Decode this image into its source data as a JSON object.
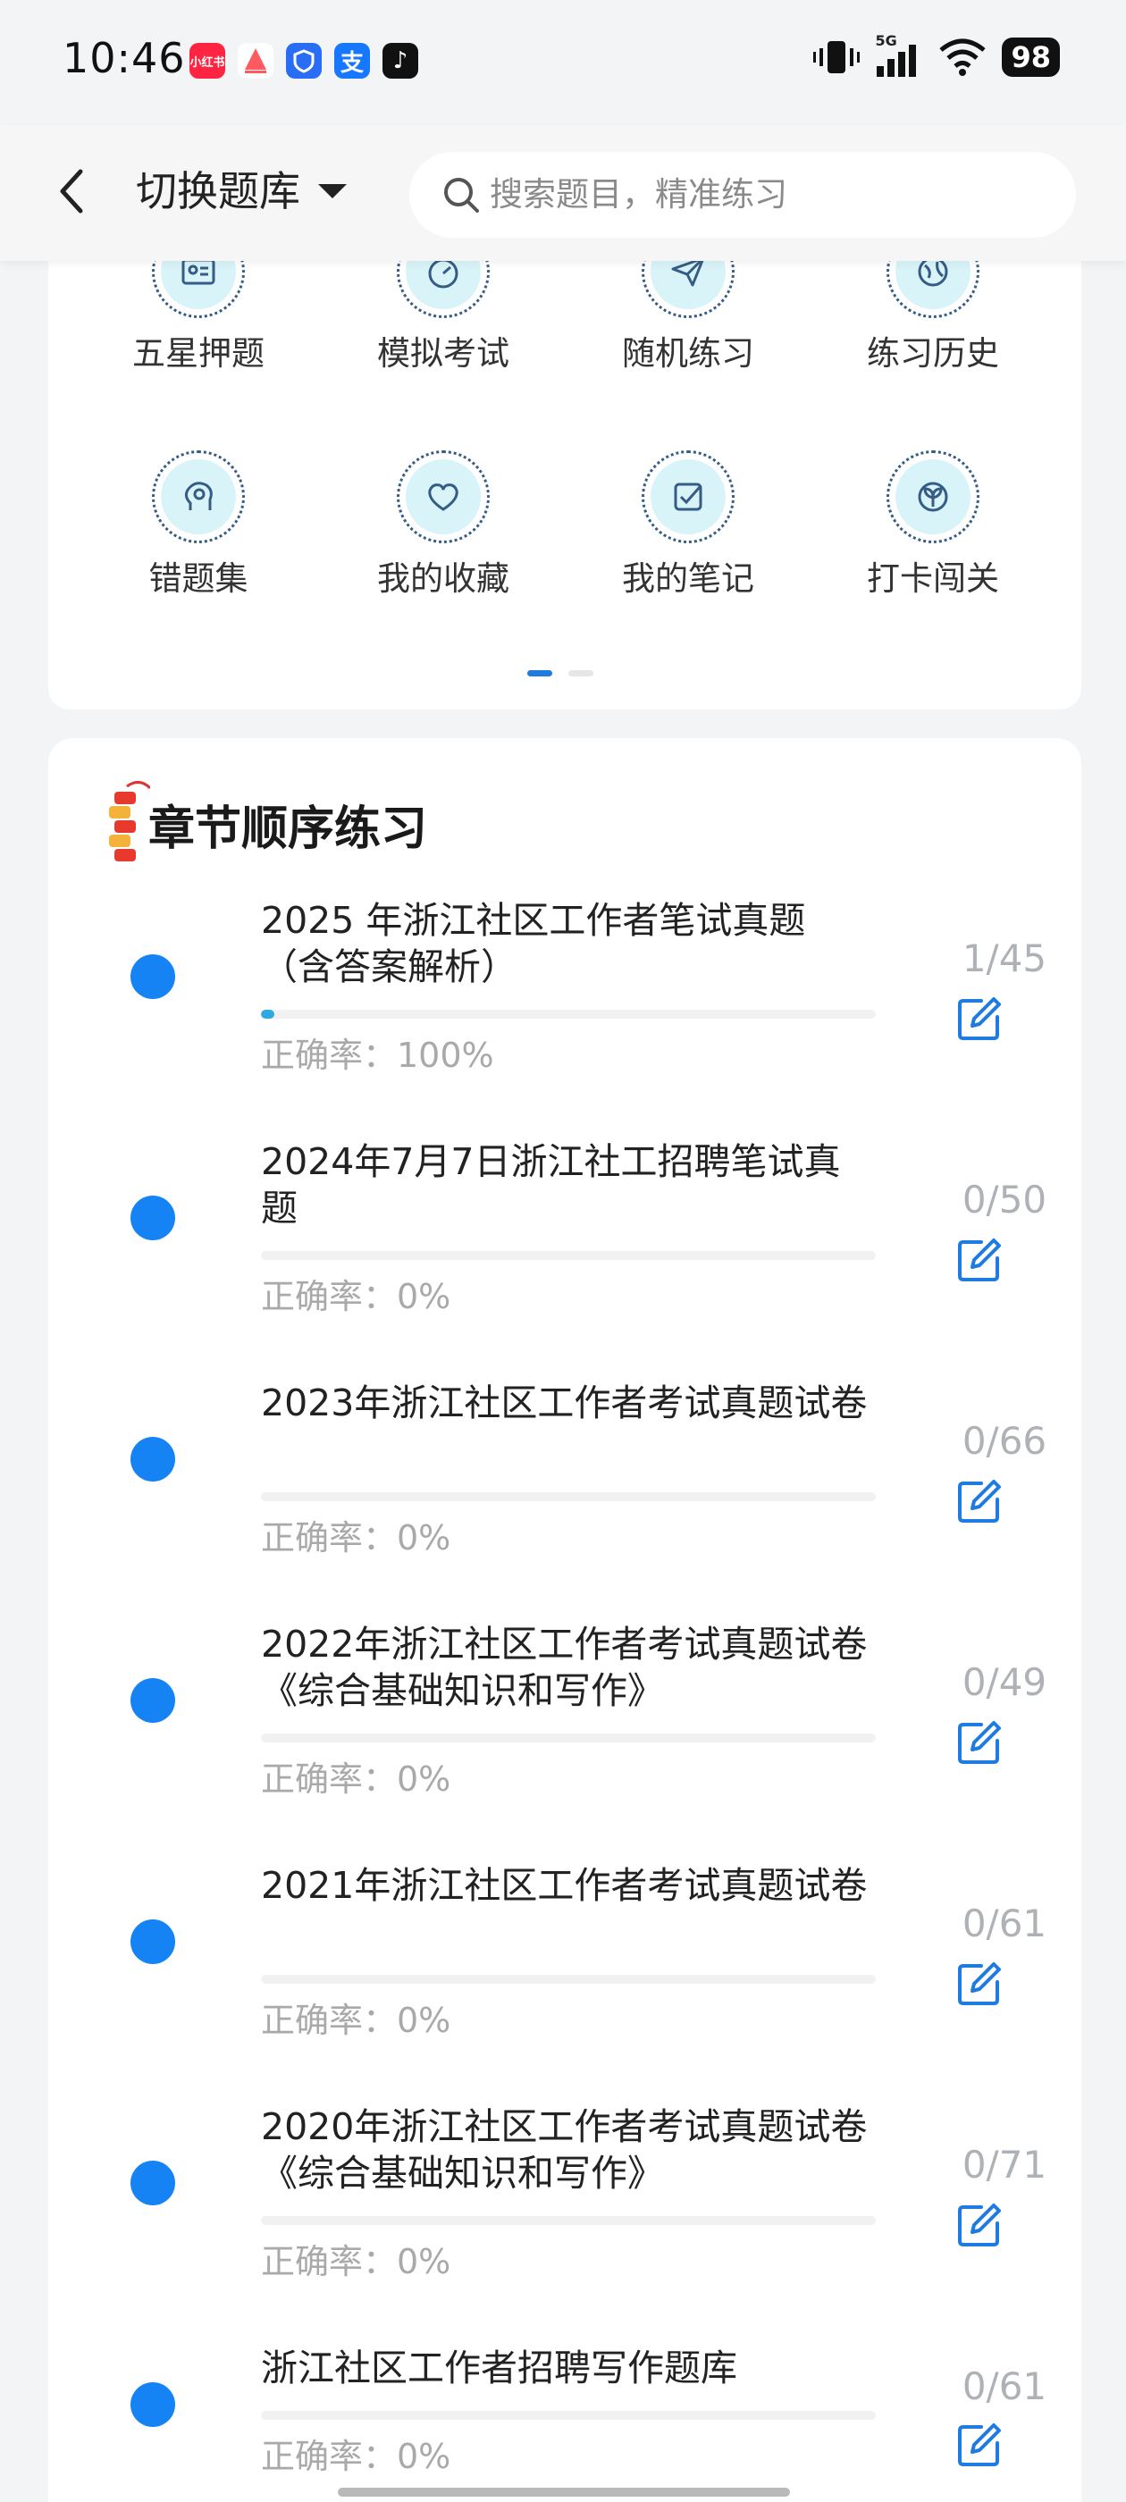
{
  "status_bar": {
    "time": "10:46",
    "apps": [
      {
        "name": "xiaohongshu-icon",
        "text": "小红书",
        "color": "#ff2442"
      },
      {
        "name": "sailboat-icon",
        "text": "",
        "color": "#ffffff"
      },
      {
        "name": "shield-app-icon",
        "text": "",
        "color": "#2a6df5"
      },
      {
        "name": "alipay-icon",
        "text": "支",
        "color": "#1677ff"
      },
      {
        "name": "douyin-icon",
        "text": "♪",
        "color": "#111111"
      }
    ],
    "network": "5G",
    "battery": "98"
  },
  "header": {
    "switch_label": "切换题库",
    "search_placeholder": "搜索题目，精准练习"
  },
  "grid": {
    "items": [
      {
        "name": "five-star-item",
        "label": "五星押题",
        "icon": "id-card-icon"
      },
      {
        "name": "mock-exam-item",
        "label": "模拟考试",
        "icon": "gauge-icon"
      },
      {
        "name": "random-practice-item",
        "label": "随机练习",
        "icon": "paper-plane-icon"
      },
      {
        "name": "practice-history-item",
        "label": "练习历史",
        "icon": "globe-icon"
      },
      {
        "name": "wrong-questions-item",
        "label": "错题集",
        "icon": "head-icon"
      },
      {
        "name": "favorites-item",
        "label": "我的收藏",
        "icon": "heart-icon"
      },
      {
        "name": "notes-item",
        "label": "我的笔记",
        "icon": "check-note-icon"
      },
      {
        "name": "checkin-item",
        "label": "打卡闯关",
        "icon": "sprout-icon"
      }
    ],
    "page_indicator": {
      "pages": 2,
      "active": 0
    }
  },
  "chapter": {
    "title": "章节顺序练习",
    "rows": [
      {
        "title": "2025 年浙江社区工作者笔试真题（含答案解析）",
        "accuracy": "正确率：100%",
        "count": "1/45",
        "progress": 0.022
      },
      {
        "title": "2024年7月7日浙江社工招聘笔试真题",
        "accuracy": "正确率：0%",
        "count": "0/50",
        "progress": 0
      },
      {
        "title": "2023年浙江社区工作者考试真题试卷",
        "accuracy": "正确率：0%",
        "count": "0/66",
        "progress": 0
      },
      {
        "title": "2022年浙江社区工作者考试真题试卷 《综合基础知识和写作》",
        "accuracy": "正确率：0%",
        "count": "0/49",
        "progress": 0
      },
      {
        "title": "2021年浙江社区工作者考试真题试卷",
        "accuracy": "正确率：0%",
        "count": "0/61",
        "progress": 0
      },
      {
        "title": "2020年浙江社区工作者考试真题试卷 《综合基础知识和写作》",
        "accuracy": "正确率：0%",
        "count": "0/71",
        "progress": 0
      },
      {
        "title": "浙江社区工作者招聘写作题库",
        "accuracy": "正确率：0%",
        "count": "0/61",
        "progress": 0
      }
    ]
  },
  "colors": {
    "accent": "#1683f5",
    "progress": "#2fa9e0",
    "icon_stroke": "#355c86",
    "icon_bg": "#d9f4f8"
  }
}
